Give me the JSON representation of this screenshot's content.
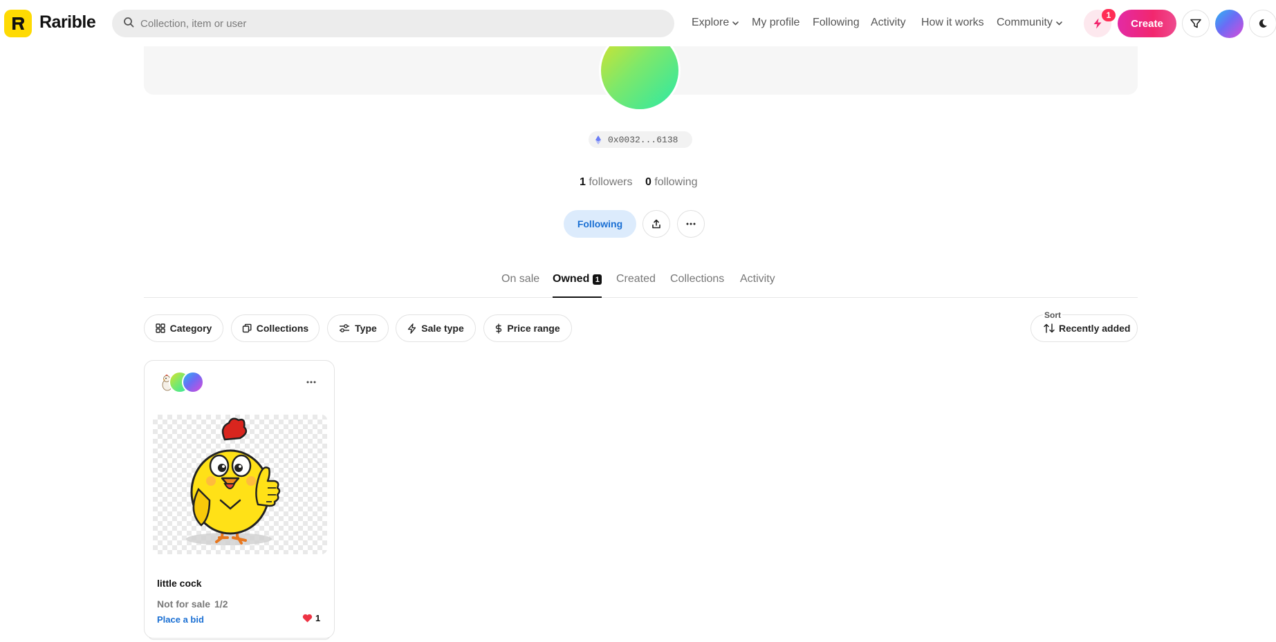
{
  "header": {
    "brand": "Rarible",
    "search_placeholder": "Collection, item or user",
    "nav": {
      "explore": "Explore",
      "my_profile": "My profile",
      "following": "Following",
      "activity": "Activity",
      "how_it_works": "How it works",
      "community": "Community"
    },
    "notifications_count": "1",
    "create_label": "Create"
  },
  "profile": {
    "address": "0x0032...6138",
    "followers_count": "1",
    "followers_label": "followers",
    "following_count": "0",
    "following_label": "following",
    "following_button": "Following"
  },
  "tabs": {
    "on_sale": "On sale",
    "owned": "Owned",
    "owned_count": "1",
    "created": "Created",
    "collections": "Collections",
    "activity": "Activity"
  },
  "filters": {
    "category": "Category",
    "collections": "Collections",
    "type": "Type",
    "sale_type": "Sale type",
    "price_range": "Price range",
    "sort_label": "Sort",
    "sort_value": "Recently added"
  },
  "card": {
    "title": "little cock",
    "status": "Not for sale",
    "edition": "1/2",
    "bid_label": "Place a bid",
    "likes": "1"
  },
  "colors": {
    "brand_yellow": "#FEDA03",
    "accent_blue": "#1a6fd3",
    "create_pink": "#f2276e",
    "badge_red": "#ff2d55"
  }
}
